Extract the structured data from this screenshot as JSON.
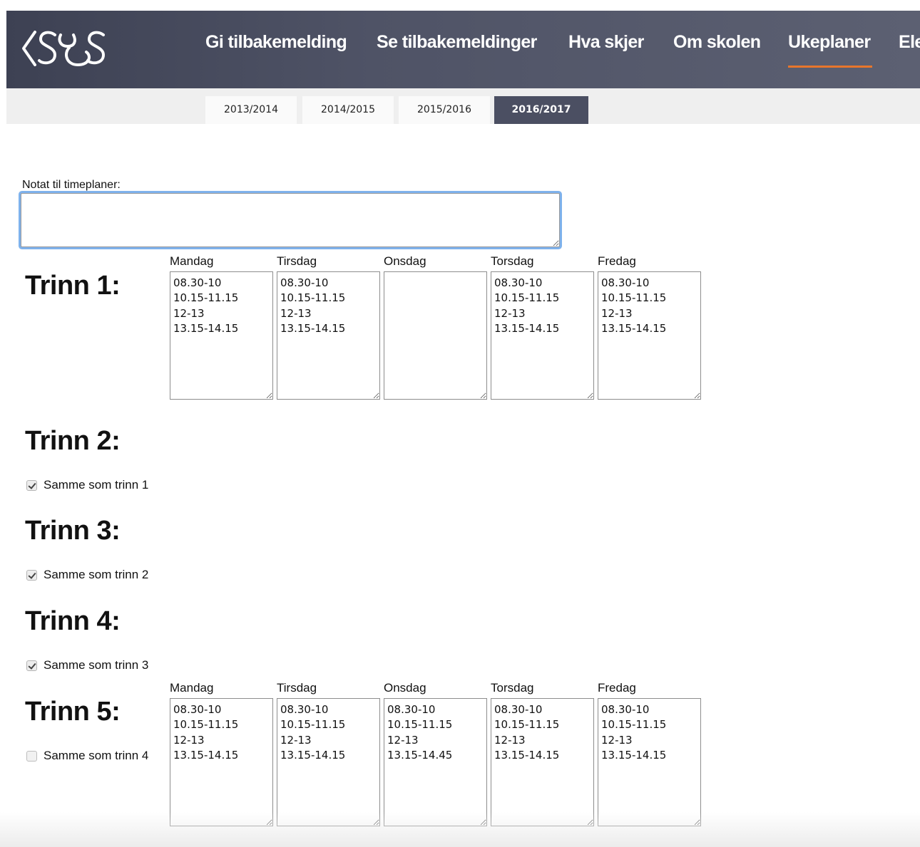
{
  "header": {
    "logo_name": "CSS logo",
    "nav": [
      {
        "label": "Gi tilbakemelding"
      },
      {
        "label": "Se tilbakemeldinger"
      },
      {
        "label": "Hva skjer"
      },
      {
        "label": "Om skolen"
      },
      {
        "label": "Ukeplaner",
        "active": true
      },
      {
        "label": "Ele"
      }
    ],
    "accent_color": "#e8762c"
  },
  "year_tabs": [
    {
      "label": "2013/2014"
    },
    {
      "label": "2014/2015"
    },
    {
      "label": "2015/2016"
    },
    {
      "label": "2016/2017",
      "active": true
    }
  ],
  "note": {
    "label": "Notat til timeplaner:",
    "value": ""
  },
  "days": [
    "Mandag",
    "Tirsdag",
    "Onsdag",
    "Torsdag",
    "Fredag"
  ],
  "trinn1": {
    "title": "Trinn 1:",
    "schedule": [
      "08.30-10\n10.15-11.15\n12-13\n13.15-14.15",
      "08.30-10\n10.15-11.15\n12-13\n13.15-14.15",
      "",
      "08.30-10\n10.15-11.15\n12-13\n13.15-14.15",
      "08.30-10\n10.15-11.15\n12-13\n13.15-14.15"
    ]
  },
  "trinn2": {
    "title": "Trinn 2:",
    "same_label": "Samme som trinn 1",
    "checked": true
  },
  "trinn3": {
    "title": "Trinn 3:",
    "same_label": "Samme som trinn 2",
    "checked": true
  },
  "trinn4": {
    "title": "Trinn 4:",
    "same_label": "Samme som trinn 3",
    "checked": true
  },
  "trinn5": {
    "title": "Trinn 5:",
    "same_label": "Samme som trinn 4",
    "checked": false,
    "schedule": [
      "08.30-10\n10.15-11.15\n12-13\n13.15-14.15",
      "08.30-10\n10.15-11.15\n12-13\n13.15-14.15",
      "08.30-10\n10.15-11.15\n12-13\n13.15-14.45",
      "08.30-10\n10.15-11.15\n12-13\n13.15-14.15",
      "08.30-10\n10.15-11.15\n12-13\n13.15-14.15"
    ]
  }
}
